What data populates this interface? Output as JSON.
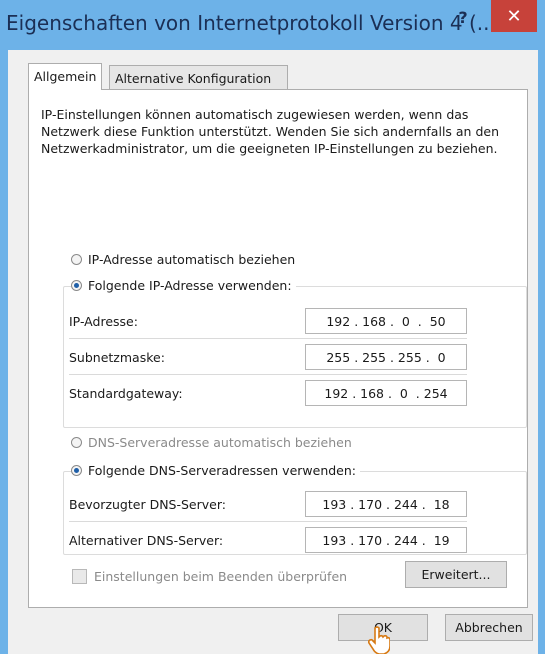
{
  "window": {
    "title": "Eigenschaften von Internetprotokoll Version 4 (..."
  },
  "titlebar": {
    "help_glyph": "?",
    "close_glyph": "✕"
  },
  "tabs": [
    {
      "label": "Allgemein",
      "active": true
    },
    {
      "label": "Alternative Konfiguration",
      "active": false
    }
  ],
  "general": {
    "intro": "IP-Einstellungen können automatisch zugewiesen werden, wenn das Netzwerk diese Funktion unterstützt. Wenden Sie sich andernfalls an den Netzwerkadministrator, um die geeigneten IP-Einstellungen zu beziehen.",
    "ip_auto_label": "IP-Adresse automatisch beziehen",
    "ip_manual_label": "Folgende IP-Adresse verwenden:",
    "ip_mode": "manual",
    "fields": {
      "ip_label": "IP-Adresse:",
      "ip_value": "192 . 168 .  0  .  50",
      "subnet_label": "Subnetzmaske:",
      "subnet_value": "255 . 255 . 255 .  0",
      "gateway_label": "Standardgateway:",
      "gateway_value": "192 . 168 .  0  . 254"
    },
    "dns_auto_label": "DNS-Serveradresse automatisch beziehen",
    "dns_manual_label": "Folgende DNS-Serveradressen verwenden:",
    "dns_mode": "manual",
    "dns": {
      "preferred_label": "Bevorzugter DNS-Server:",
      "preferred_value": "193 . 170 . 244 .  18",
      "alternate_label": "Alternativer DNS-Server:",
      "alternate_value": "193 . 170 . 244 .  19"
    },
    "validate_label": "Einstellungen beim Beenden überprüfen",
    "advanced_button": "Erweitert..."
  },
  "footer": {
    "ok_button": "OK",
    "cancel_button": "Abbrechen"
  },
  "colors": {
    "titlebar": "#6db2e8",
    "close": "#c7423a",
    "radio_dot": "#1f5fa8"
  }
}
